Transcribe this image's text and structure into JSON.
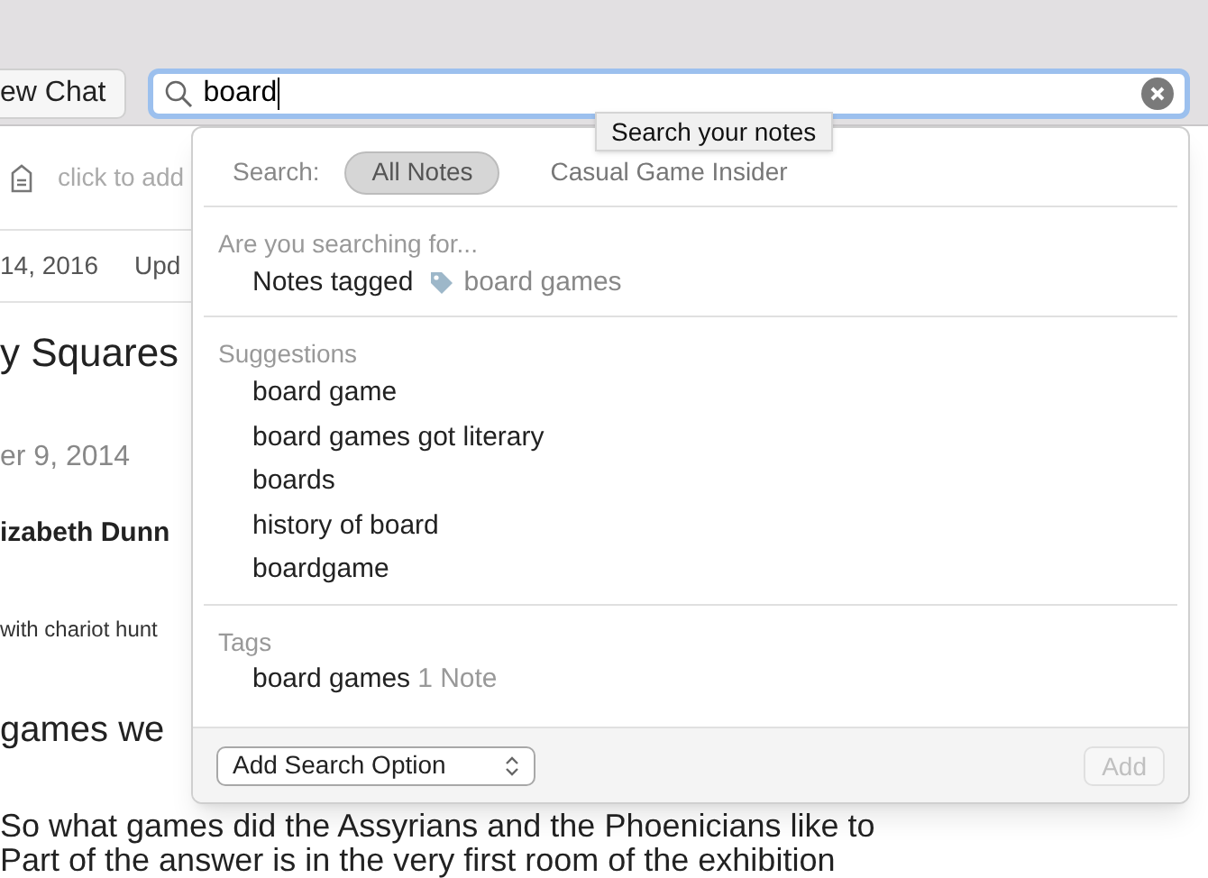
{
  "toolbar": {
    "new_chat_button": "ew Chat",
    "search": {
      "value": "board",
      "focused": true
    }
  },
  "tooltip": "Search your notes",
  "note": {
    "tag_hint": "click to add",
    "created": "14, 2016",
    "updated": "Upd",
    "title": "y Squares",
    "date": "er 9, 2014",
    "author": "izabeth Dunn",
    "caption": "with chariot hunt",
    "body": [
      "games we",
      "So what games did the Assyrians and the Phoenicians like to",
      "Part of the answer is in the very first room of the exhibition"
    ]
  },
  "popover": {
    "scope_label": "Search:",
    "scopes": [
      {
        "label": "All Notes",
        "selected": true
      },
      {
        "label": "Casual Game Insider",
        "selected": false
      }
    ],
    "sections": [
      {
        "heading": "Are you searching for...",
        "items": [
          {
            "kind": "tag_query",
            "text": "Notes tagged",
            "tag": "board games"
          }
        ]
      },
      {
        "heading": "Suggestions",
        "items": [
          {
            "kind": "text",
            "text": "board game"
          },
          {
            "kind": "text",
            "text": "board games got literary"
          },
          {
            "kind": "text",
            "text": "boards"
          },
          {
            "kind": "text",
            "text": "history of board"
          },
          {
            "kind": "text",
            "text": "boardgame"
          }
        ]
      },
      {
        "heading": "Tags",
        "items": [
          {
            "kind": "count",
            "text": "board games",
            "count": "1 Note"
          }
        ]
      }
    ],
    "option_select": "Add Search Option",
    "add_button": {
      "label": "Add",
      "disabled": true
    }
  }
}
